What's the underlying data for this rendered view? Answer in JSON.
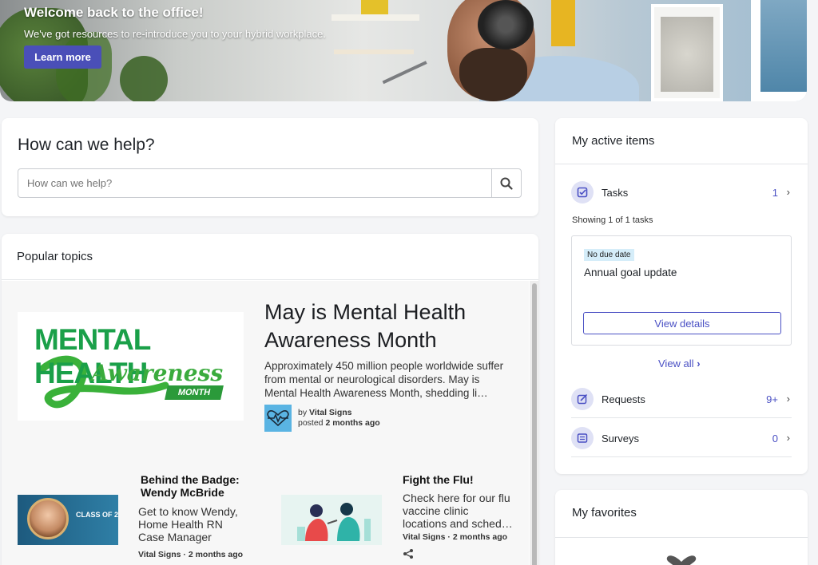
{
  "hero": {
    "title": "Welcome back to the office!",
    "subtitle": "We've got resources to re-introduce you to your hybrid workplace.",
    "button_label": "Learn more"
  },
  "help": {
    "title": "How can we help?",
    "search_placeholder": "How can we help?",
    "search_icon": "search-icon"
  },
  "popular": {
    "title": "Popular topics",
    "featured": {
      "image_text_line1": "MENTAL HEALTH",
      "image_text_line2": "Awareness",
      "image_text_line3": "MONTH",
      "title": "May is Mental Health Awareness Month",
      "description": "Approximately 450 million people worldwide suffer from mental or neurological disorders. May is Mental Health Awareness Month, shedding li…",
      "author_prefix": "by",
      "author": "Vital Signs",
      "posted_prefix": "posted",
      "posted": "2 months ago"
    },
    "articles": [
      {
        "title": "Behind the Badge: Wendy McBride",
        "description": "Get to know Wendy, Home Health RN Case Manager",
        "meta": "Vital Signs · 2 months ago",
        "image_text": "CLASS OF 2"
      },
      {
        "title": "Fight the Flu!",
        "description": "Check here for our flu vaccine clinic locations and sched…",
        "meta": "Vital Signs · 2 months ago"
      }
    ]
  },
  "active": {
    "title": "My active items",
    "tasks": {
      "label": "Tasks",
      "count": "1"
    },
    "showing": "Showing 1 of 1 tasks",
    "task": {
      "tag": "No due date",
      "title": "Annual goal update",
      "button": "View details"
    },
    "view_all": "View all",
    "requests": {
      "label": "Requests",
      "count": "9+"
    },
    "surveys": {
      "label": "Surveys",
      "count": "0"
    }
  },
  "favorites": {
    "title": "My favorites"
  },
  "colors": {
    "accent": "#4a50c4",
    "hero_button": "#4a4fb8",
    "green": "#1aa049"
  }
}
